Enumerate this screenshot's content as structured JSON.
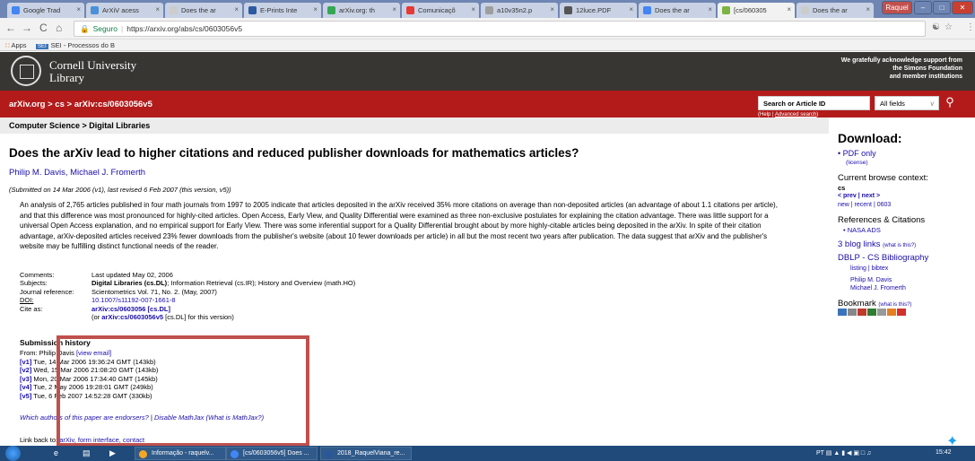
{
  "browser": {
    "tabs": [
      {
        "label": "Google Trad",
        "color": "#4285f4"
      },
      {
        "label": "ArXiV acess",
        "color": "#4a90d9"
      },
      {
        "label": "Does the ar",
        "color": "#cccccc"
      },
      {
        "label": "E-Prints Inte",
        "color": "#2b5aa0"
      },
      {
        "label": "arXiv.org: th",
        "color": "#34a853"
      },
      {
        "label": "Comunicaçõ",
        "color": "#e53935"
      },
      {
        "label": "a10v35n2.p",
        "color": "#9e9e9e"
      },
      {
        "label": "12luce.PDF",
        "color": "#555555"
      },
      {
        "label": "Does the ar",
        "color": "#4285f4"
      },
      {
        "label": "[cs/060305",
        "color": "#7cb342"
      },
      {
        "label": "Does the ar",
        "color": "#cccccc"
      }
    ],
    "profile": "Raquel",
    "nav": {
      "back": "←",
      "forward": "→",
      "reload": "C",
      "home": "⌂"
    },
    "address": {
      "secure_label": "Seguro",
      "url": "https://arxiv.org/abs/cs/0603056v5"
    },
    "bookmarks": {
      "apps": "Apps",
      "sei_badge": "SEI",
      "sei_label": "SEI - Processos do B"
    }
  },
  "header": {
    "org_name": "Cornell University",
    "org_sub": "Library",
    "support_line1": "We gratefully acknowledge support from",
    "support_line2": "the Simons Foundation",
    "support_line3": "and member institutions"
  },
  "redbar": {
    "breadcrumb": "arXiv.org > cs > arXiv:cs/0603056v5",
    "search_placeholder": "Search or Article ID",
    "field_select": "All fields",
    "help_prefix": "(Help | ",
    "help_link": "Advanced search",
    "help_suffix": ")"
  },
  "subject_header": "Computer Science > Digital Libraries",
  "paper": {
    "title": "Does the arXiv lead to higher citations and reduced publisher downloads for mathematics articles?",
    "authors": "Philip M. Davis, Michael J. Fromerth",
    "submitted": "(Submitted on 14 Mar 2006 (v1), last revised 6 Feb 2007 (this version, v5))",
    "abstract": "An analysis of 2,765 articles published in four math journals from 1997 to 2005 indicate that articles deposited in the arXiv received 35% more citations on average than non-deposited articles (an advantage of about 1.1 citations per article), and that this difference was most pronounced for highly-cited articles. Open Access, Early View, and Quality Differential were examined as three non-exclusive postulates for explaining the citation advantage. There was little support for a universal Open Access explanation, and no empirical support for Early View. There was some inferential support for a Quality Differential brought about by more highly-citable articles being deposited in the arXiv. In spite of their citation advantage, arXiv-deposited articles received 23% fewer downloads from the publisher's website (about 10 fewer downloads per article) in all but the most recent two years after publication. The data suggest that arXiv and the publisher's website may be fulfilling distinct functional needs of the reader."
  },
  "metadata": {
    "comments_label": "Comments:",
    "comments_value": "Last updated May 02, 2006",
    "subjects_label": "Subjects:",
    "subjects_primary": "Digital Libraries (cs.DL)",
    "subjects_rest": "; Information Retrieval (cs.IR); History and Overview (math.HO)",
    "journal_label": "Journal reference:",
    "journal_value": "Scientometrics Vol. 71, No. 2. (May, 2007)",
    "doi_label": "DOI:",
    "doi_value": "10.1007/s11192-007-1661-8",
    "cite_label": "Cite as:",
    "cite_value": "arXiv:cs/0603056 [cs.DL]",
    "cite_alt_prefix": "(or ",
    "cite_alt_link": "arXiv:cs/0603056v5",
    "cite_alt_suffix": " [cs.DL] for this version)"
  },
  "history": {
    "title": "Submission history",
    "from_prefix": "From: Philip Davis ",
    "from_link": "[view email]",
    "versions": [
      {
        "v": "[v1]",
        "text": " Tue, 14 Mar 2006 19:36:24 GMT (143kb)"
      },
      {
        "v": "[v2]",
        "text": " Wed, 15 Mar 2006 21:08:20 GMT (143kb)"
      },
      {
        "v": "[v3]",
        "text": " Mon, 20 Mar 2006 17:34:40 GMT (145kb)"
      },
      {
        "v": "[v4]",
        "text": " Tue, 2 May 2006 19:28:01 GMT (249kb)"
      },
      {
        "v": "[v5]",
        "text": " Tue, 6 Feb 2007 14:52:28 GMT (330kb)"
      }
    ],
    "endorse_link": "Which authors of this paper are endorsers?",
    "endorse_sep": " | ",
    "mathjax_link": "Disable MathJax",
    "mathjax_what": " (What is MathJax?)",
    "linkback_prefix": "Link back to: ",
    "linkback_link": "arXiv, form interface, contact"
  },
  "sidebar": {
    "download_title": "Download:",
    "pdf_only": "PDF only",
    "license": "(license)",
    "browse_title": "Current browse context:",
    "browse_context": "cs",
    "prev_next": "< prev | next >",
    "browse_links": "new | recent | 0603",
    "refs_title": "References & Citations",
    "nasa_ads": "NASA ADS",
    "blog_links": "3 blog links",
    "blog_what": "(what is this?)",
    "dblp_title": "DBLP - CS Bibliography",
    "dblp_links": "listing | bibtex",
    "dblp_author1": "Philip M. Davis",
    "dblp_author2": "Michael J. Fromerth",
    "bookmark_title": "Bookmark",
    "bookmark_what": "(what is this?)"
  },
  "taskbar": {
    "items": [
      {
        "label": "Informação - raquelv...",
        "color": "#f5a623"
      },
      {
        "label": "[cs/0603056v5] Does ...",
        "color": "#4285f4"
      },
      {
        "label": "2018_RaquelViana_re...",
        "color": "#2b579a"
      }
    ],
    "lang": "PT",
    "clock": "15:42"
  }
}
